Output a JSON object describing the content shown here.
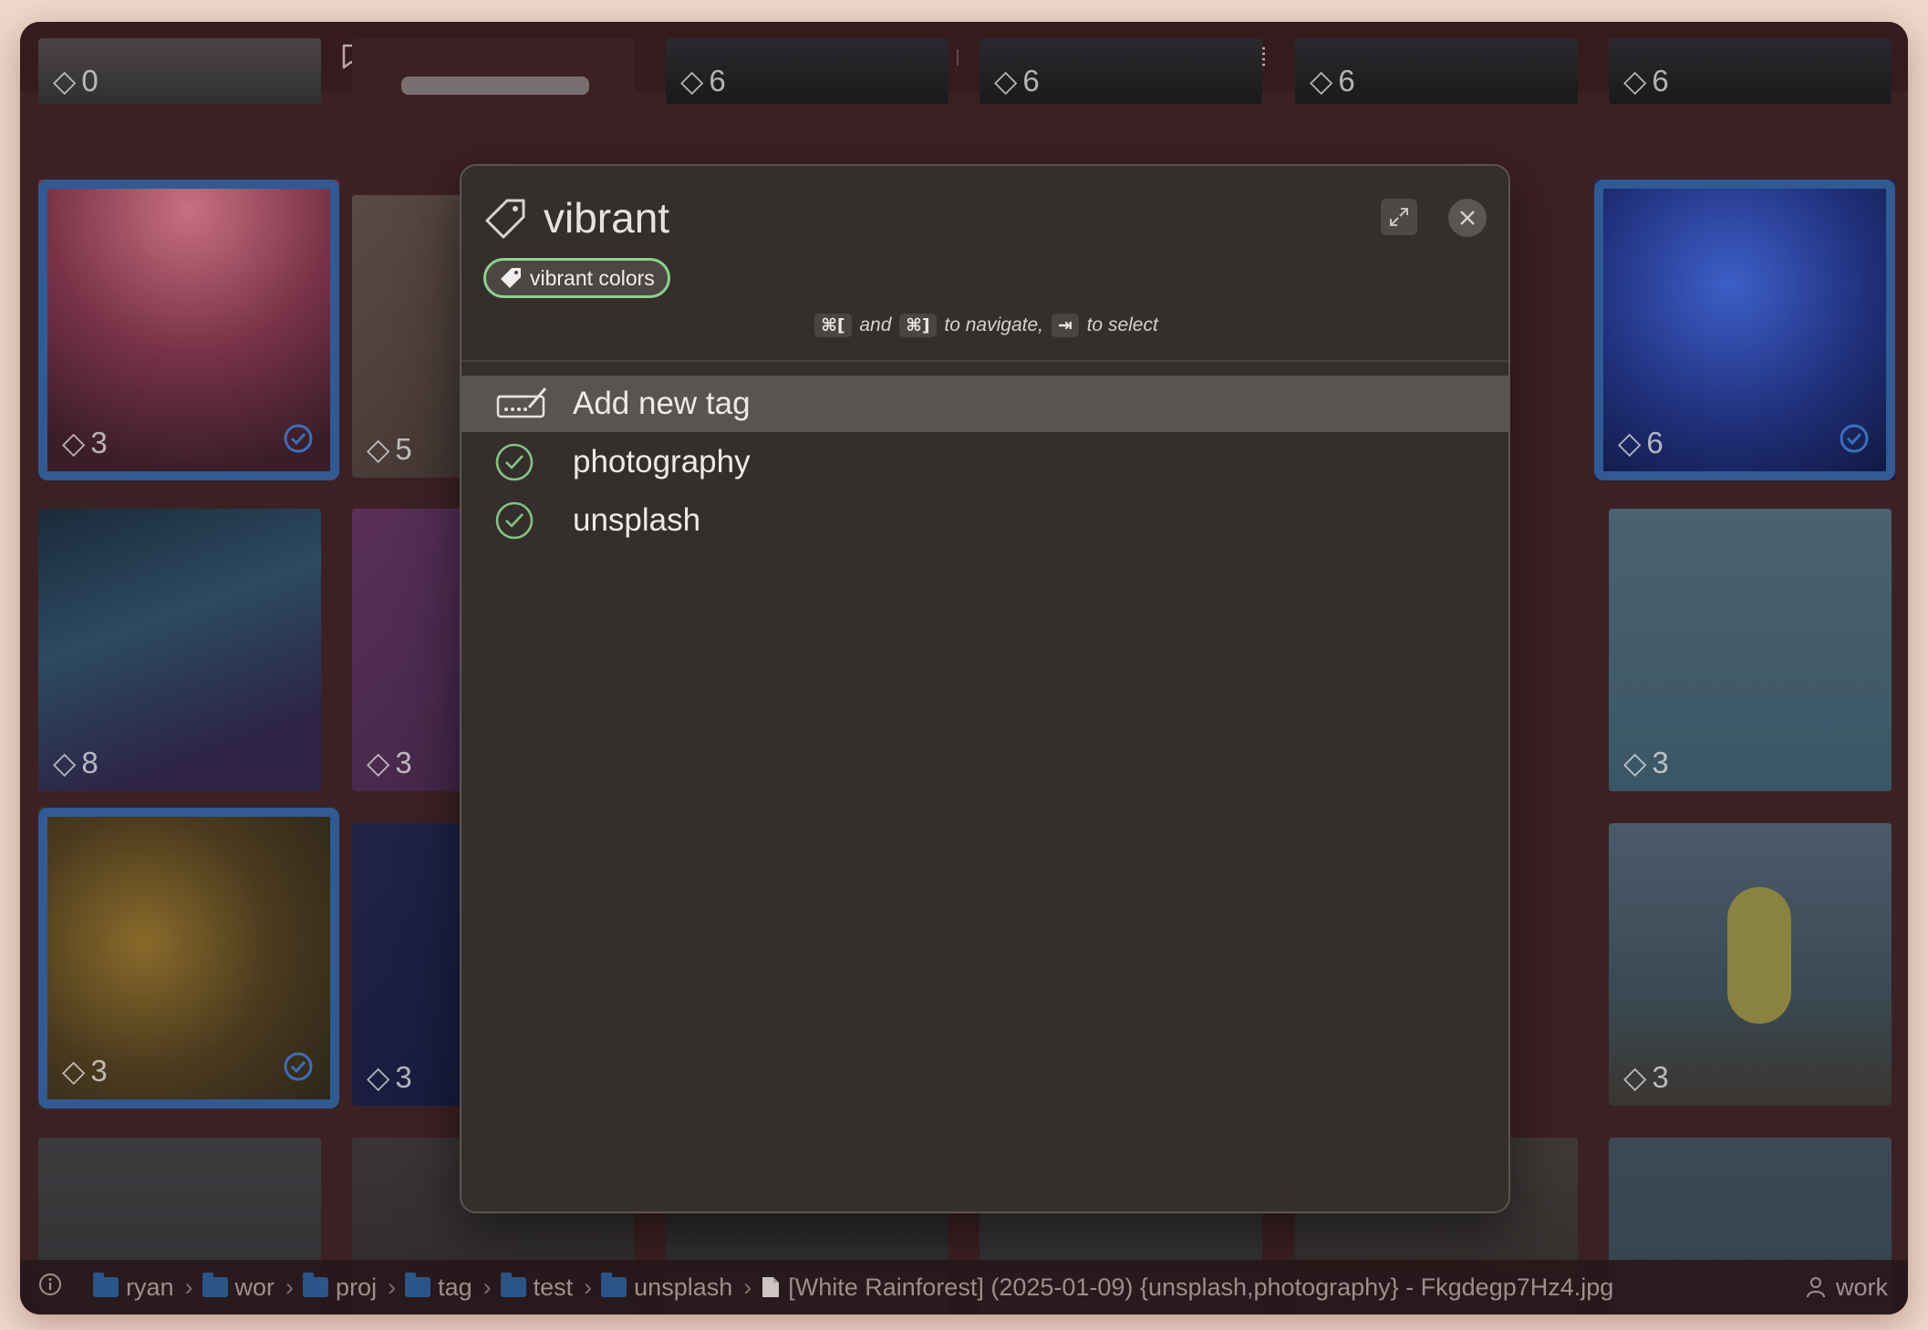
{
  "toolbar": {
    "icons": [
      "sidebar-toggle-icon",
      "back-chevron-icon",
      "up-chevron-icon",
      "bookmark-icon",
      "small-grid-icon",
      "large-grid-icon",
      "database-icon",
      "search-icon",
      "graph-icon",
      "folder-icon",
      "sort-list-icon",
      "grid-view-icon",
      "list-view-icon"
    ],
    "zoom_level": 0.2
  },
  "grid": {
    "partial_counts": [
      "0",
      "6",
      "6",
      "6",
      "6"
    ],
    "tiles": [
      {
        "count": "3",
        "selected": true,
        "checked": true
      },
      {
        "count": "5",
        "selected": false,
        "checked": false
      },
      {
        "count": "6",
        "selected": true,
        "checked": true
      },
      {
        "count": "8",
        "selected": false,
        "checked": false
      },
      {
        "count": "3",
        "selected": false,
        "checked": false
      },
      {
        "count": "3",
        "selected": false,
        "checked": false
      },
      {
        "count": "3",
        "selected": true,
        "checked": true
      },
      {
        "count": "3",
        "selected": false,
        "checked": false
      },
      {
        "count": "3",
        "selected": false,
        "checked": false
      }
    ]
  },
  "dialog": {
    "search_value": "vibrant",
    "chip_label": "vibrant colors",
    "hint": {
      "key1": "⌘[",
      "and": "and",
      "key2": "⌘]",
      "to_navigate": "to navigate,",
      "key3": "⇥",
      "to_select": "to select"
    },
    "options": [
      {
        "label": "Add new tag",
        "icon": "add-tag-icon",
        "highlighted": true
      },
      {
        "label": "photography",
        "icon": "check-circle-icon",
        "highlighted": false
      },
      {
        "label": "unsplash",
        "icon": "check-circle-icon",
        "highlighted": false
      }
    ]
  },
  "statusbar": {
    "crumbs": [
      "ryan",
      "wor",
      "proj",
      "tag",
      "test",
      "unsplash"
    ],
    "file_name": "[White Rainforest] (2025-01-09) {unsplash,photography} - Fkgdegp7Hz4.jpg",
    "user": "work"
  },
  "colors": {
    "window_bg": "#3c2124",
    "selection": "#2f5a94",
    "dialog_bg": "#342f2d",
    "chip_border": "#8fd28c",
    "check_green": "#86c285",
    "traffic_close": "#4b3537",
    "traffic_min": "#f6be38",
    "traffic_max": "#4fc244"
  }
}
